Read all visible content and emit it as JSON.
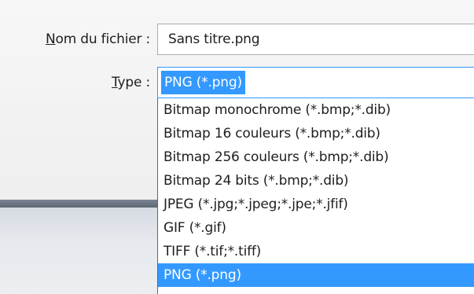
{
  "dialog": {
    "filename_label_accel": "N",
    "filename_label_rest": "om du fichier :",
    "filename_value": "Sans titre.png",
    "type_label_accel": "T",
    "type_label_rest": "ype :",
    "type_selected": "PNG (*.png)"
  },
  "type_options": [
    {
      "label": "Bitmap monochrome (*.bmp;*.dib)",
      "highlighted": false
    },
    {
      "label": "Bitmap 16 couleurs (*.bmp;*.dib)",
      "highlighted": false
    },
    {
      "label": "Bitmap 256 couleurs (*.bmp;*.dib)",
      "highlighted": false
    },
    {
      "label": "Bitmap 24 bits (*.bmp;*.dib)",
      "highlighted": false
    },
    {
      "label": "JPEG (*.jpg;*.jpeg;*.jpe;*.jfif)",
      "highlighted": false
    },
    {
      "label": "GIF (*.gif)",
      "highlighted": false
    },
    {
      "label": "TIFF (*.tif;*.tiff)",
      "highlighted": false
    },
    {
      "label": "PNG (*.png)",
      "highlighted": true
    }
  ],
  "colors": {
    "selection": "#3399ff",
    "text": "#1e1e1e",
    "input_border": "#acacac",
    "focus_border": "#3399ff"
  }
}
